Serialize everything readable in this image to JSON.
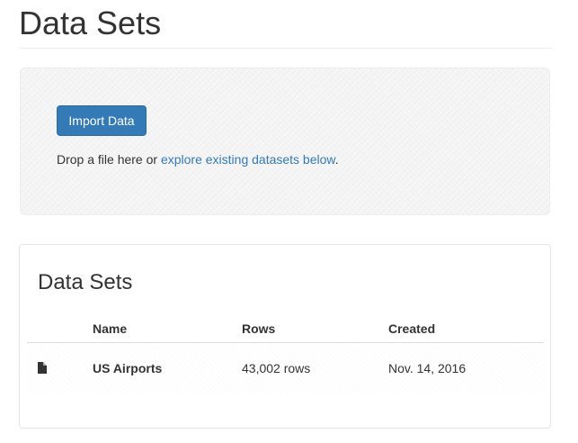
{
  "header": {
    "title": "Data Sets"
  },
  "dropzone": {
    "import_label": "Import Data",
    "text_prefix": "Drop a file here or ",
    "link_text": "explore existing datasets below",
    "text_suffix": "."
  },
  "datasets_panel": {
    "title": "Data Sets",
    "columns": [
      "Name",
      "Rows",
      "Created"
    ],
    "rows": [
      {
        "icon": "file-icon",
        "name": "US Airports",
        "rows": "43,002 rows",
        "created": "Nov. 14, 2016"
      }
    ]
  },
  "colors": {
    "primary": "#337ab7",
    "text": "#333333"
  }
}
